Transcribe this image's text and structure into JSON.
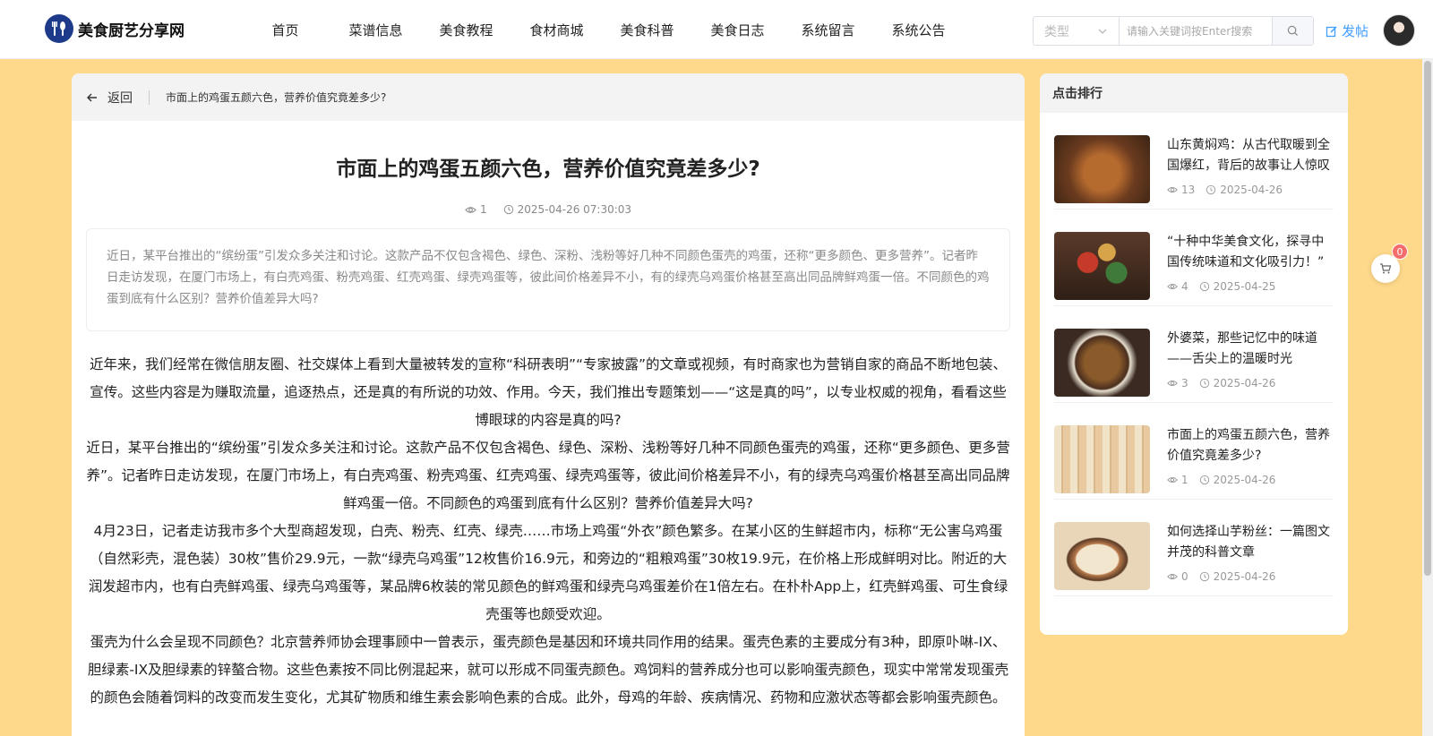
{
  "site": {
    "logo_text": "美食厨艺分享网"
  },
  "nav": {
    "items": [
      {
        "label": "首页"
      },
      {
        "label": "菜谱信息"
      },
      {
        "label": "美食教程"
      },
      {
        "label": "食材商城"
      },
      {
        "label": "美食科普"
      },
      {
        "label": "美食日志"
      },
      {
        "label": "系统留言"
      },
      {
        "label": "系统公告"
      }
    ]
  },
  "search": {
    "type_placeholder": "类型",
    "placeholder": "请输入关键词按Enter搜索",
    "value": ""
  },
  "post_button": {
    "label": "发帖"
  },
  "article": {
    "back_label": "返回",
    "breadcrumb_title": "市面上的鸡蛋五颜六色，营养价值究竟差多少?",
    "title": "市面上的鸡蛋五颜六色，营养价值究竟差多少?",
    "views": "1",
    "date": "2025-04-26 07:30:03",
    "summary": "近日，某平台推出的“缤纷蛋”引发众多关注和讨论。这款产品不仅包含褐色、绿色、深粉、浅粉等好几种不同颜色蛋壳的鸡蛋，还称“更多颜色、更多营养”。记者昨日走访发现，在厦门市场上，有白壳鸡蛋、粉壳鸡蛋、红壳鸡蛋、绿壳鸡蛋等，彼此间价格差异不小，有的绿壳乌鸡蛋价格甚至高出同品牌鲜鸡蛋一倍。不同颜色的鸡蛋到底有什么区别？营养价值差异大吗?",
    "paragraphs": [
      "近年来，我们经常在微信朋友圈、社交媒体上看到大量被转发的宣称“科研表明”“专家披露”的文章或视频，有时商家也为营销自家的商品不断地包装、宣传。这些内容是为赚取流量，追逐热点，还是真的有所说的功效、作用。今天，我们推出专题策划——“这是真的吗”，以专业权威的视角，看看这些博眼球的内容是真的吗?",
      "近日，某平台推出的“缤纷蛋”引发众多关注和讨论。这款产品不仅包含褐色、绿色、深粉、浅粉等好几种不同颜色蛋壳的鸡蛋，还称“更多颜色、更多营养”。记者昨日走访发现，在厦门市场上，有白壳鸡蛋、粉壳鸡蛋、红壳鸡蛋、绿壳鸡蛋等，彼此间价格差异不小，有的绿壳乌鸡蛋价格甚至高出同品牌鲜鸡蛋一倍。不同颜色的鸡蛋到底有什么区别？营养价值差异大吗?",
      "4月23日，记者走访我市多个大型商超发现，白壳、粉壳、红壳、绿壳……市场上鸡蛋“外衣”颜色繁多。在某小区的生鲜超市内，标称“无公害乌鸡蛋（自然彩壳，混色装）30枚”售价29.9元，一款“绿壳乌鸡蛋”12枚售价16.9元，和旁边的“粗粮鸡蛋”30枚19.9元，在价格上形成鲜明对比。附近的大润发超市内，也有白壳鲜鸡蛋、绿壳乌鸡蛋等，某品牌6枚装的常见颜色的鲜鸡蛋和绿壳乌鸡蛋差价在1倍左右。在朴朴App上，红壳鲜鸡蛋、可生食绿壳蛋等也颇受欢迎。",
      "蛋壳为什么会呈现不同颜色？北京营养师协会理事顾中一曾表示，蛋壳颜色是基因和环境共同作用的结果。蛋壳色素的主要成分有3种，即原卟啉-IX、胆绿素-IX及胆绿素的锌螯合物。这些色素按不同比例混起来，就可以形成不同蛋壳颜色。鸡饲料的营养成分也可以影响蛋壳颜色，现实中常常发现蛋壳的颜色会随着饲料的改变而发生变化，尤其矿物质和维生素会影响色素的合成。此外，母鸡的年龄、疾病情况、药物和应激状态等都会影响蛋壳颜色。"
    ]
  },
  "rank": {
    "title": "点击排行",
    "items": [
      {
        "title": "山东黄焖鸡：从古代取暖到全国爆红，背后的故事让人惊叹",
        "views": "13",
        "date": "2025-04-26",
        "thumb_color": "#7a4a2a"
      },
      {
        "title": "“十种中华美食文化，探寻中国传统味道和文化吸引力！”",
        "views": "4",
        "date": "2025-04-25",
        "thumb_color": "#5a3a2a"
      },
      {
        "title": "外婆菜，那些记忆中的味道——舌尖上的温暖时光",
        "views": "3",
        "date": "2025-04-26",
        "thumb_color": "#4a2e1e"
      },
      {
        "title": "市面上的鸡蛋五颜六色，营养价值究竟差多少?",
        "views": "1",
        "date": "2025-04-26",
        "thumb_color": "#c9a77a"
      },
      {
        "title": "如何选择山芋粉丝：一篇图文并茂的科普文章",
        "views": "0",
        "date": "2025-04-26",
        "thumb_color": "#d9c3a0"
      }
    ]
  },
  "cart": {
    "count": "0"
  }
}
